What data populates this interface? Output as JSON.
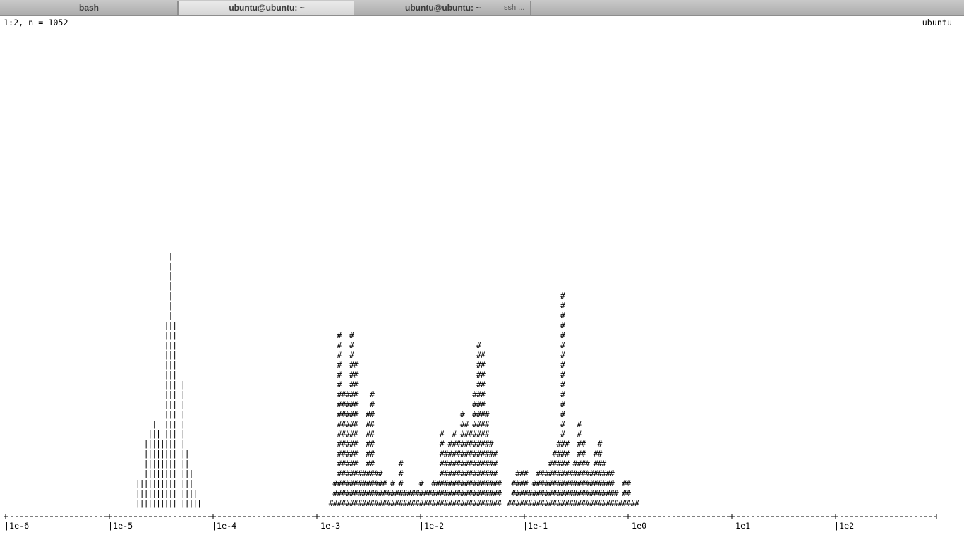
{
  "tabs": [
    {
      "label": "bash",
      "active": false
    },
    {
      "label": "ubuntu@ubuntu: ~",
      "active": true
    },
    {
      "label": "ubuntu@ubuntu: ~",
      "sublabel": "ssh ...",
      "active": false
    }
  ],
  "status": {
    "left": "1:2, n = 1052",
    "right": "ubuntu"
  },
  "chart_data": {
    "type": "bar",
    "x_scale": "log",
    "axis": {
      "ticks": [
        "|1e-6",
        "|1e-5",
        "|1e-4",
        "|1e-3",
        "|1e-2",
        "|1e-1",
        "|1e0",
        "|1e1",
        "|1e2"
      ],
      "tick_values": [
        1e-06,
        1e-05,
        0.0001,
        0.001,
        0.01,
        0.1,
        1,
        10,
        100
      ],
      "range": [
        1e-06,
        1000
      ]
    },
    "series": [
      {
        "glyph": "|",
        "columns": [
          {
            "x": 1e-06,
            "height": 7
          },
          {
            "x": 1.78e-05,
            "height": 3
          },
          {
            "x": 1.95e-05,
            "height": 3
          },
          {
            "x": 2.14e-05,
            "height": 7
          },
          {
            "x": 2.34e-05,
            "height": 8
          },
          {
            "x": 2.57e-05,
            "height": 9
          },
          {
            "x": 2.81e-05,
            "height": 8
          },
          {
            "x": 3.08e-05,
            "height": 7
          },
          {
            "x": 3.37e-05,
            "height": 19
          },
          {
            "x": 3.69e-05,
            "height": 26
          },
          {
            "x": 4.04e-05,
            "height": 19
          },
          {
            "x": 4.43e-05,
            "height": 14
          },
          {
            "x": 4.85e-05,
            "height": 13
          },
          {
            "x": 5.31e-05,
            "height": 6
          },
          {
            "x": 5.82e-05,
            "height": 4
          },
          {
            "x": 6.37e-05,
            "height": 2
          },
          {
            "x": 6.98e-05,
            "height": 1
          }
        ]
      },
      {
        "glyph": "#",
        "columns": [
          {
            "x": 0.0013,
            "height": 1
          },
          {
            "x": 0.00142,
            "height": 3
          },
          {
            "x": 0.00156,
            "height": 18
          },
          {
            "x": 0.00171,
            "height": 12
          },
          {
            "x": 0.00187,
            "height": 12
          },
          {
            "x": 0.00205,
            "height": 18
          },
          {
            "x": 0.00224,
            "height": 15
          },
          {
            "x": 0.00246,
            "height": 4
          },
          {
            "x": 0.00269,
            "height": 4
          },
          {
            "x": 0.00295,
            "height": 10
          },
          {
            "x": 0.00323,
            "height": 12
          },
          {
            "x": 0.00354,
            "height": 4
          },
          {
            "x": 0.00388,
            "height": 4
          },
          {
            "x": 0.00425,
            "height": 3
          },
          {
            "x": 0.00465,
            "height": 2
          },
          {
            "x": 0.0051,
            "height": 3
          },
          {
            "x": 0.00558,
            "height": 2
          },
          {
            "x": 0.00611,
            "height": 5
          },
          {
            "x": 0.00669,
            "height": 2
          },
          {
            "x": 0.00733,
            "height": 2
          },
          {
            "x": 0.00803,
            "height": 2
          },
          {
            "x": 0.0088,
            "height": 2
          },
          {
            "x": 0.00964,
            "height": 3
          },
          {
            "x": 0.0106,
            "height": 2
          },
          {
            "x": 0.0116,
            "height": 2
          },
          {
            "x": 0.0127,
            "height": 3
          },
          {
            "x": 0.0139,
            "height": 3
          },
          {
            "x": 0.0152,
            "height": 8
          },
          {
            "x": 0.0166,
            "height": 6
          },
          {
            "x": 0.0182,
            "height": 7
          },
          {
            "x": 0.02,
            "height": 8
          },
          {
            "x": 0.0219,
            "height": 7
          },
          {
            "x": 0.024,
            "height": 10
          },
          {
            "x": 0.0262,
            "height": 9
          },
          {
            "x": 0.0287,
            "height": 8
          },
          {
            "x": 0.0314,
            "height": 12
          },
          {
            "x": 0.0344,
            "height": 17
          },
          {
            "x": 0.0377,
            "height": 16
          },
          {
            "x": 0.0413,
            "height": 10
          },
          {
            "x": 0.0453,
            "height": 7
          },
          {
            "x": 0.0496,
            "height": 6
          },
          {
            "x": 0.0543,
            "height": 3
          },
          {
            "x": 0.068,
            "height": 1
          },
          {
            "x": 0.0745,
            "height": 3
          },
          {
            "x": 0.0816,
            "height": 4
          },
          {
            "x": 0.0894,
            "height": 4
          },
          {
            "x": 0.0979,
            "height": 4
          },
          {
            "x": 0.107,
            "height": 2
          },
          {
            "x": 0.118,
            "height": 3
          },
          {
            "x": 0.129,
            "height": 4
          },
          {
            "x": 0.141,
            "height": 4
          },
          {
            "x": 0.155,
            "height": 4
          },
          {
            "x": 0.169,
            "height": 5
          },
          {
            "x": 0.185,
            "height": 6
          },
          {
            "x": 0.203,
            "height": 7
          },
          {
            "x": 0.222,
            "height": 22
          },
          {
            "x": 0.244,
            "height": 7
          },
          {
            "x": 0.267,
            "height": 4
          },
          {
            "x": 0.292,
            "height": 5
          },
          {
            "x": 0.32,
            "height": 9
          },
          {
            "x": 0.351,
            "height": 7
          },
          {
            "x": 0.384,
            "height": 5
          },
          {
            "x": 0.421,
            "height": 4
          },
          {
            "x": 0.461,
            "height": 6
          },
          {
            "x": 0.505,
            "height": 7
          },
          {
            "x": 0.553,
            "height": 5
          },
          {
            "x": 0.606,
            "height": 4
          },
          {
            "x": 0.663,
            "height": 4
          },
          {
            "x": 0.727,
            "height": 2
          },
          {
            "x": 0.796,
            "height": 1
          },
          {
            "x": 0.872,
            "height": 3
          },
          {
            "x": 0.955,
            "height": 3
          },
          {
            "x": 1.05,
            "height": 1
          },
          {
            "x": 1.15,
            "height": 1
          }
        ]
      }
    ]
  }
}
